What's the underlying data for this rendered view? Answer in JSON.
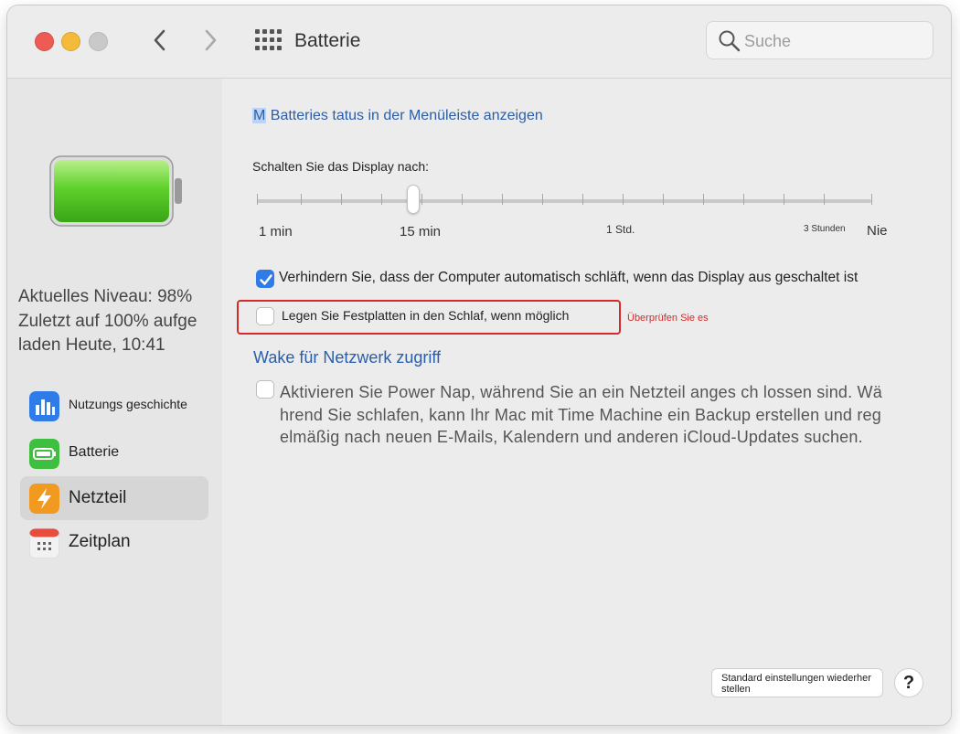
{
  "window": {
    "title": "Batterie"
  },
  "search": {
    "placeholder": "Suche"
  },
  "sidebar": {
    "status_lines": [
      "Aktuelles Niveau: 98%",
      "Zuletzt auf 100% aufge",
      "laden Heute, 10:41"
    ],
    "items": [
      {
        "label": "Nutzungs geschichte",
        "icon": "bar-chart-icon",
        "selected": false
      },
      {
        "label": "Batterie",
        "icon": "battery-icon",
        "selected": false
      },
      {
        "label": "Netzteil",
        "icon": "lightning-bolt-icon",
        "selected": true
      },
      {
        "label": "Zeitplan",
        "icon": "calendar-icon",
        "selected": false
      }
    ]
  },
  "main": {
    "show_status": {
      "label": "Batteries tatus in der Menüleiste anzeigen",
      "prefix": "M"
    },
    "display_sleep": {
      "label": "Schalten Sie das Display nach:",
      "tick_labels": [
        "1 min",
        "15 min",
        "1 Std.",
        "3 Stunden",
        "Nie"
      ],
      "value": "15 min"
    },
    "prevent_sleep": {
      "label": "Verhindern Sie, dass der Computer automatisch schläft, wenn das Display aus geschaltet ist",
      "checked": true
    },
    "disk_sleep": {
      "label": "Legen Sie Festplatten in den Schlaf, wenn möglich",
      "checked": false,
      "note": "Überprüfen Sie es"
    },
    "wake_network": {
      "label": "Wake für Netzwerk zugriff"
    },
    "power_nap": {
      "lines": [
        "Aktivieren Sie Power Nap, während Sie an ein Netzteil anges ch lossen sind. Wä",
        "hrend Sie schlafen, kann Ihr Mac mit Time Machine ein Backup erstellen und reg",
        "elmäßig nach neuen E-Mails, Kalendern und anderen iCloud-Updates suchen."
      ],
      "checked": false
    },
    "restore_defaults": "Standard einstellungen wiederher stellen",
    "help": "?"
  },
  "colors": {
    "accent": "#2f7ce8",
    "highlight": "#d62a2a",
    "link": "#2a5ea8"
  }
}
